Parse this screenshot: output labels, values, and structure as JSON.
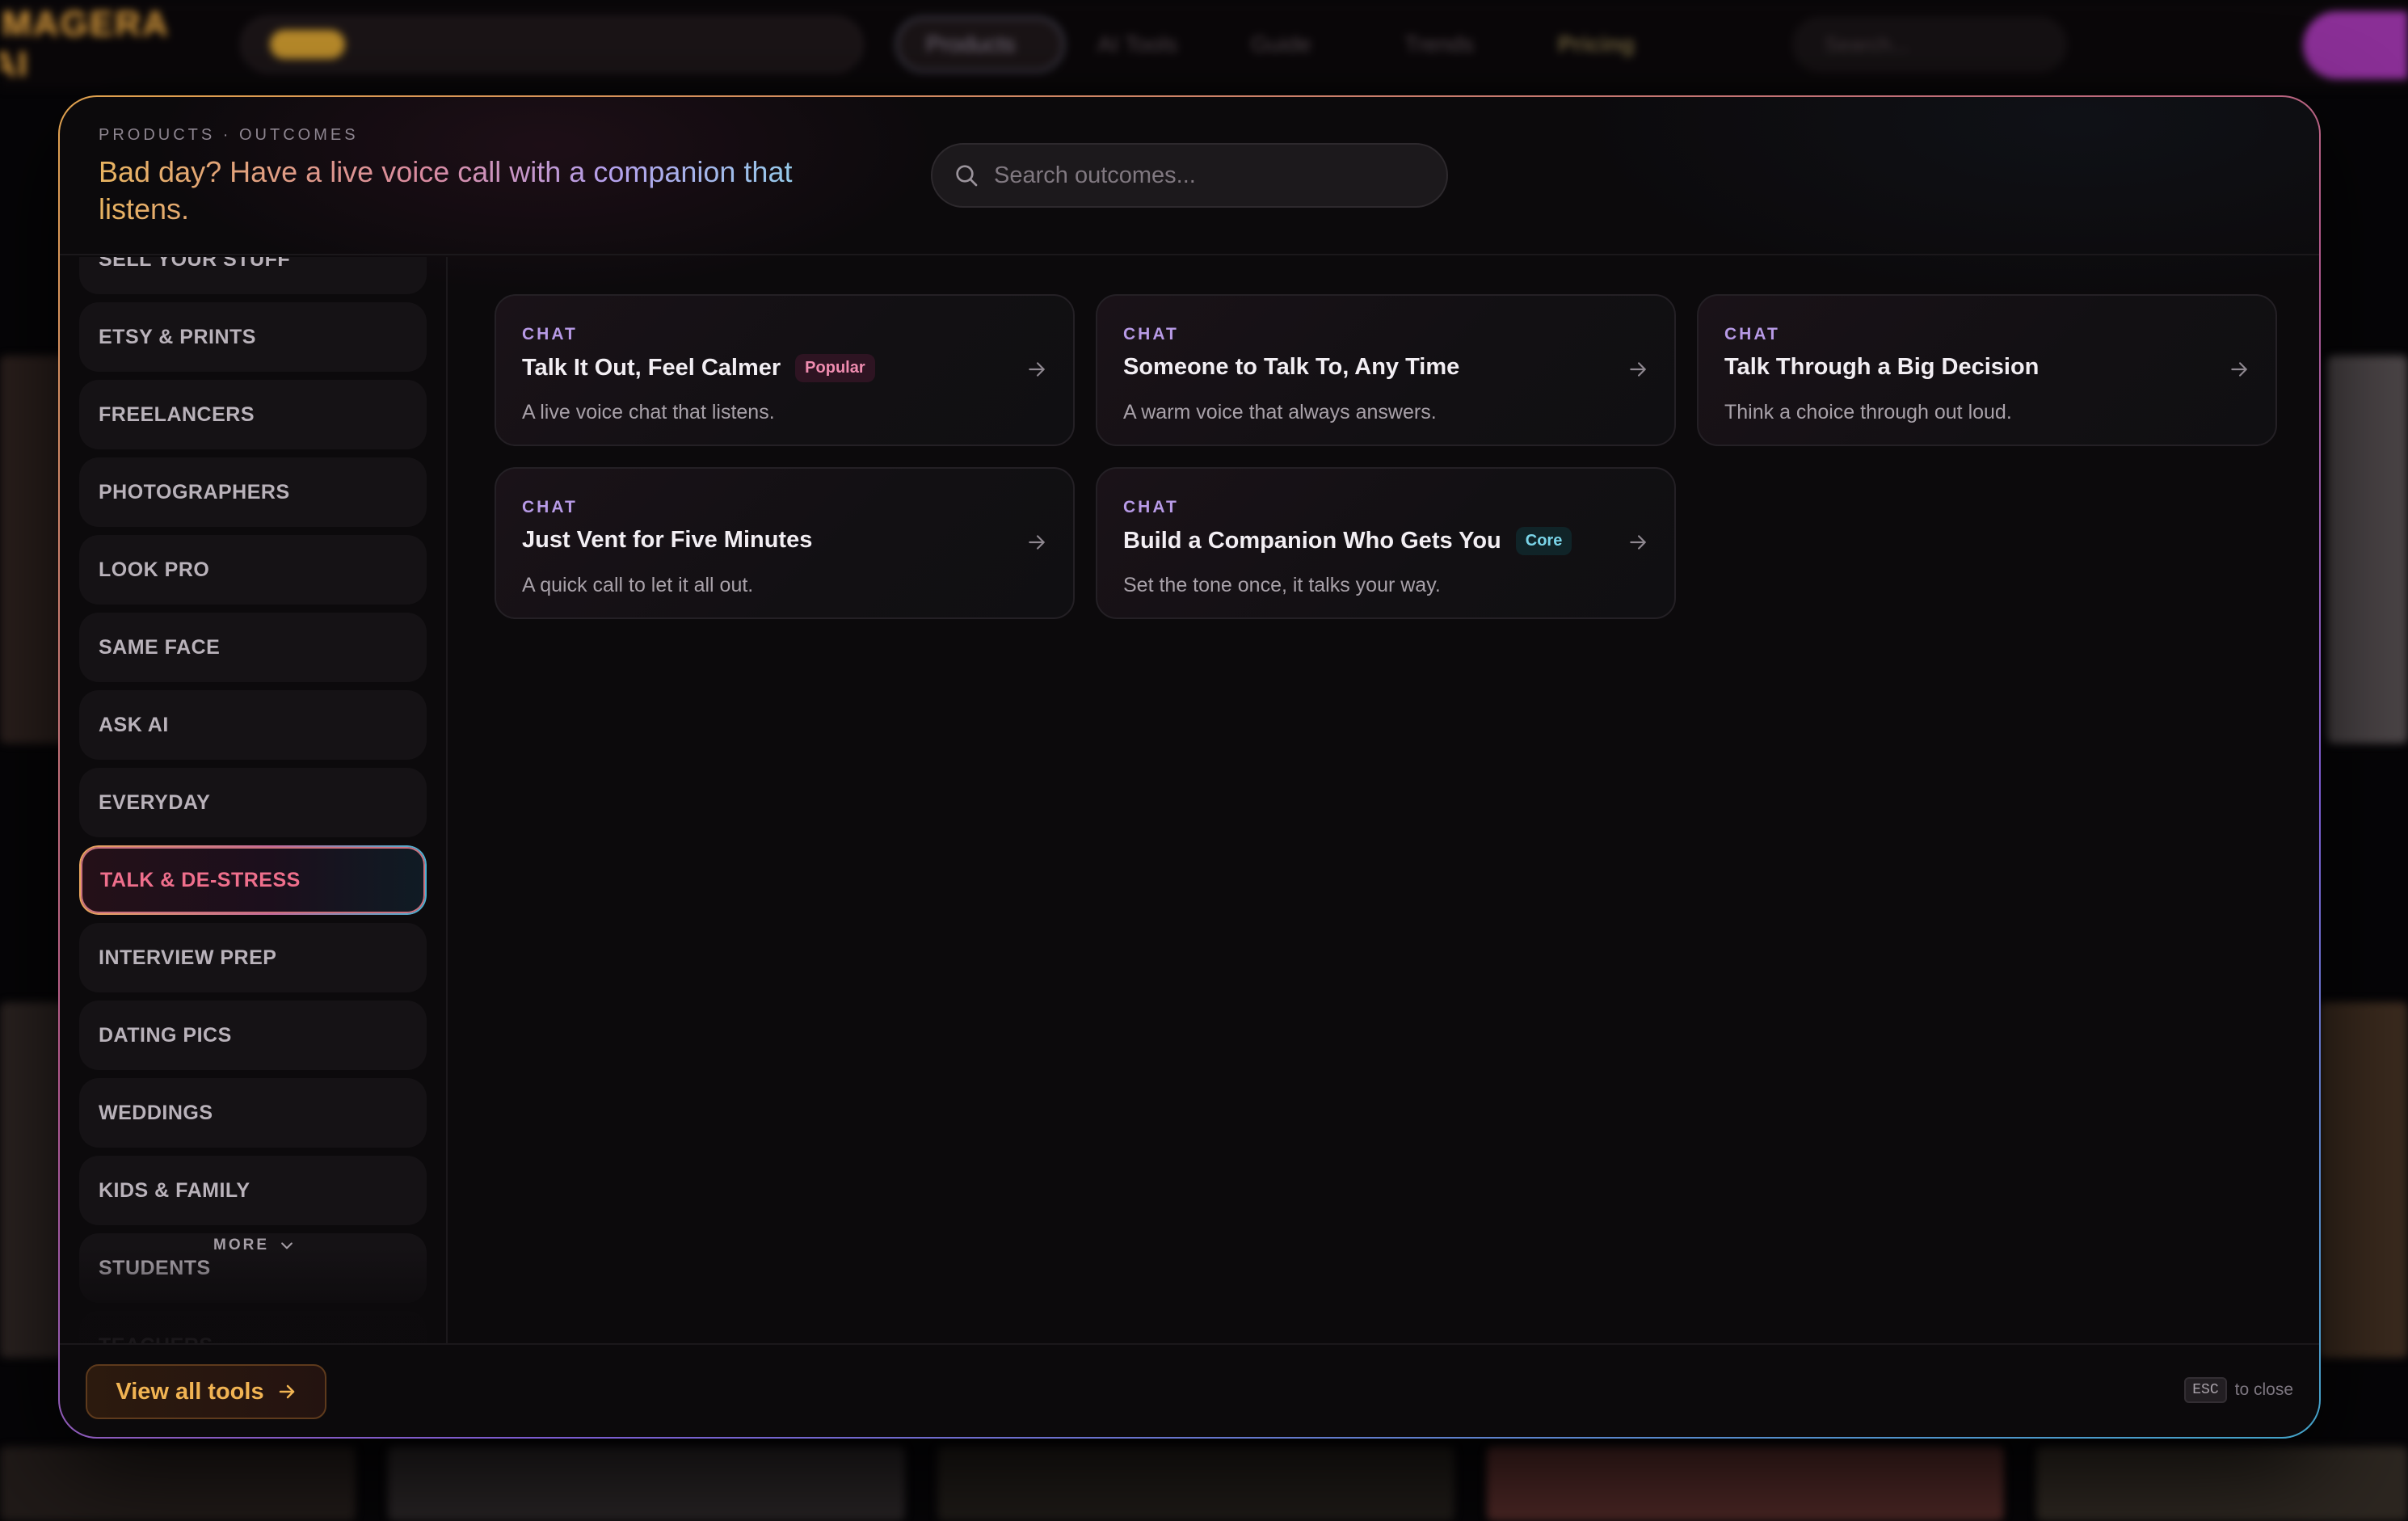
{
  "background_nav": {
    "logo": "IMAGERA AI",
    "promo_badge": "",
    "products_label": "Products",
    "links": [
      "AI Tools",
      "Guide",
      "Trends"
    ],
    "pricing_label": "Pricing",
    "search_placeholder": "Search..."
  },
  "modal": {
    "breadcrumb": "PRODUCTS · OUTCOMES",
    "headline": "Bad day? Have a live voice call with a companion that listens.",
    "search": {
      "placeholder": "Search outcomes..."
    },
    "sidebar": {
      "items": [
        {
          "label": "SELL YOUR STUFF",
          "active": false
        },
        {
          "label": "ETSY & PRINTS",
          "active": false
        },
        {
          "label": "FREELANCERS",
          "active": false
        },
        {
          "label": "PHOTOGRAPHERS",
          "active": false
        },
        {
          "label": "LOOK PRO",
          "active": false
        },
        {
          "label": "SAME FACE",
          "active": false
        },
        {
          "label": "ASK AI",
          "active": false
        },
        {
          "label": "EVERYDAY",
          "active": false
        },
        {
          "label": "TALK & DE-STRESS",
          "active": true
        },
        {
          "label": "INTERVIEW PREP",
          "active": false
        },
        {
          "label": "DATING PICS",
          "active": false
        },
        {
          "label": "WEDDINGS",
          "active": false
        },
        {
          "label": "KIDS & FAMILY",
          "active": false
        },
        {
          "label": "STUDENTS",
          "active": false
        },
        {
          "label": "TEACHERS",
          "active": false
        }
      ],
      "more_label": "MORE"
    },
    "cards": [
      {
        "tag": "CHAT",
        "title": "Talk It Out, Feel Calmer",
        "badge": "Popular",
        "description": "A live voice chat that listens."
      },
      {
        "tag": "CHAT",
        "title": "Someone to Talk To, Any Time",
        "badge": "",
        "description": "A warm voice that always answers."
      },
      {
        "tag": "CHAT",
        "title": "Talk Through a Big Decision",
        "badge": "",
        "description": "Think a choice through out loud."
      },
      {
        "tag": "CHAT",
        "title": "Just Vent for Five Minutes",
        "badge": "",
        "description": "A quick call to let it all out."
      },
      {
        "tag": "CHAT",
        "title": "Build a Companion Who Gets You",
        "badge": "Core",
        "description": "Set the tone once, it talks your way."
      }
    ],
    "footer": {
      "view_all_label": "View all tools",
      "esc_key": "ESC",
      "esc_hint": "to close"
    }
  },
  "colors": {
    "accent_gold": "#f1b453",
    "accent_pink": "#ef6f8c",
    "accent_violet": "#b79ae6",
    "accent_cyan": "#7ad4e8",
    "modal_bg": "#0c0a0c"
  }
}
